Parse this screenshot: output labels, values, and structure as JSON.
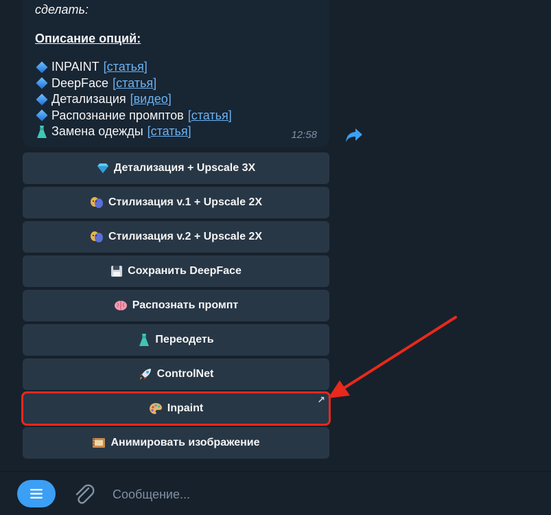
{
  "message": {
    "intro_text": "сделать:",
    "section_title": "Описание опций:",
    "options": [
      {
        "icon": "blue-diamond-icon",
        "name": "INPAINT",
        "link": "[статья]"
      },
      {
        "icon": "blue-diamond-icon",
        "name": "DeepFace",
        "link": "[статья]"
      },
      {
        "icon": "blue-diamond-icon",
        "name": "Детализация",
        "link": "[видео]"
      },
      {
        "icon": "blue-diamond-icon",
        "name": "Распознание промптов",
        "link": "[статья]"
      },
      {
        "icon": "dress-icon",
        "name": "Замена одежды",
        "link": "[статья]"
      }
    ],
    "time": "12:58"
  },
  "keyboard": [
    {
      "icon": "gem-icon",
      "label": "Детализация + Upscale 3X"
    },
    {
      "icon": "theater-masks-icon",
      "label": "Стилизация v.1 + Upscale 2X"
    },
    {
      "icon": "theater-masks-icon",
      "label": "Стилизация v.2 + Upscale 2X"
    },
    {
      "icon": "floppy-disk-icon",
      "label": "Сохранить DeepFace"
    },
    {
      "icon": "brain-icon",
      "label": "Распознать промпт"
    },
    {
      "icon": "dress-icon",
      "label": "Переодеть"
    },
    {
      "icon": "rocket-icon",
      "label": "ControlNet"
    },
    {
      "icon": "palette-icon",
      "label": "Inpaint",
      "corner": "↗"
    },
    {
      "icon": "film-frames-icon",
      "label": "Анимировать изображение"
    }
  ],
  "composer": {
    "placeholder": "Сообщение..."
  },
  "colors": {
    "background": "#17212b",
    "bubble": "#182533",
    "button": "#283746",
    "link": "#6ab3f3",
    "accent": "#3b9ff5",
    "highlight": "#e8291c"
  }
}
